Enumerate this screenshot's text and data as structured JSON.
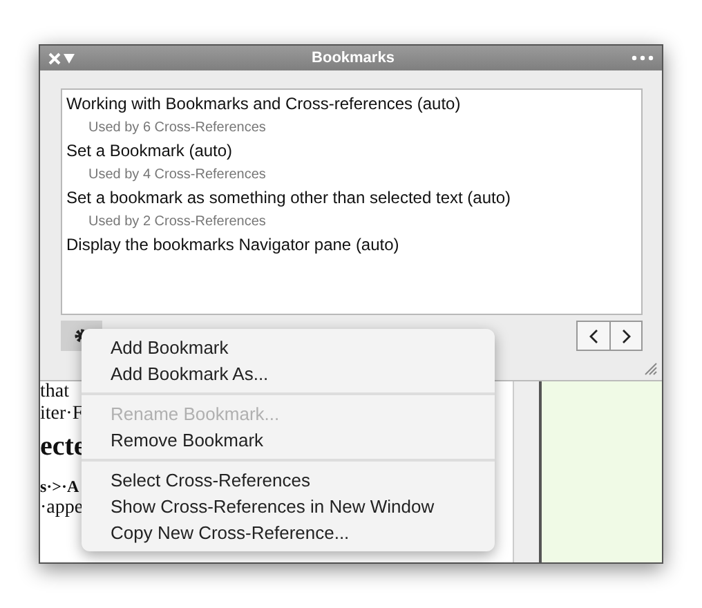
{
  "window": {
    "title": "Bookmarks"
  },
  "bookmarks": [
    {
      "title": "Working with Bookmarks and Cross-references (auto)",
      "usage": "Used by 6 Cross-References"
    },
    {
      "title": "Set a Bookmark (auto)",
      "usage": "Used by 4 Cross-References"
    },
    {
      "title": "Set a bookmark as something other than selected text (auto)",
      "usage": "Used by 2 Cross-References"
    },
    {
      "title": "Display the bookmarks Navigator pane (auto)"
    }
  ],
  "menu": [
    [
      {
        "label": "Add Bookmark",
        "disabled": false
      },
      {
        "label": "Add Bookmark As...",
        "disabled": false
      }
    ],
    [
      {
        "label": "Rename Bookmark...",
        "disabled": true
      },
      {
        "label": "Remove Bookmark",
        "disabled": false
      }
    ],
    [
      {
        "label": "Select Cross-References",
        "disabled": false
      },
      {
        "label": "Show Cross-References in New Window",
        "disabled": false
      },
      {
        "label": "Copy New Cross-Reference...",
        "disabled": false
      }
    ]
  ],
  "document": [
    {
      "text": "that",
      "kind": "plain"
    },
    {
      "text": "iter·F",
      "kind": "plain"
    },
    {
      "text": "ecte",
      "kind": "heading"
    },
    {
      "text": "s·>·A",
      "kind": "bold"
    },
    {
      "text": "·appe",
      "kind": "plain"
    }
  ]
}
